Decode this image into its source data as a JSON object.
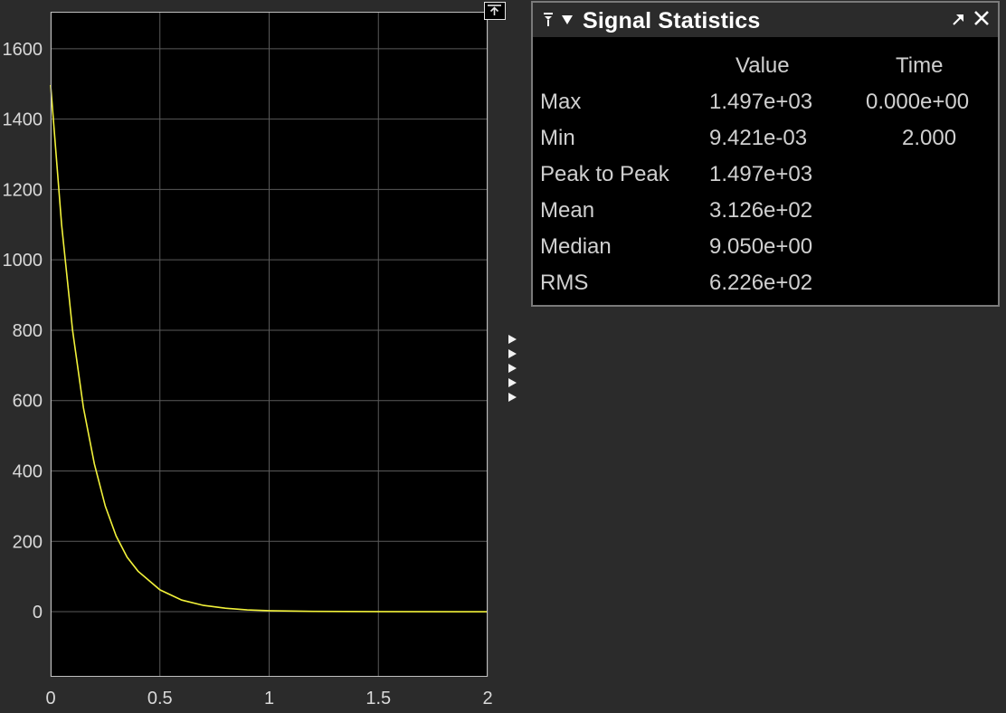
{
  "scope": {
    "axes": {
      "x_ticks": [
        "0",
        "0.5",
        "1",
        "1.5",
        "2"
      ],
      "y_ticks": [
        "1600",
        "1400",
        "1200",
        "1000",
        "800",
        "600",
        "400",
        "200",
        "0"
      ],
      "background": "#000000",
      "grid_color": "#5a5a5a",
      "trace_color": "#f2f23a",
      "label_color": "#d9d9d9"
    },
    "chart_data": {
      "type": "line",
      "title": "",
      "xlabel": "",
      "ylabel": "",
      "xlim": [
        0,
        2
      ],
      "ylim": [
        -185,
        1705
      ],
      "grid": true,
      "series": [
        {
          "x": [
            0,
            0.05,
            0.1,
            0.15,
            0.2,
            0.25,
            0.3,
            0.35,
            0.4,
            0.5,
            0.6,
            0.7,
            0.8,
            0.9,
            1.0,
            1.2,
            1.5,
            2.0
          ],
          "y": [
            1497,
            1100,
            800,
            580,
            420,
            300,
            215,
            155,
            115,
            62,
            33,
            18,
            10,
            5,
            3,
            1,
            0.3,
            0.01
          ]
        }
      ]
    },
    "undock_icon": "undock-icon",
    "side_arrow_icon": "triangle-right-icon"
  },
  "stats": {
    "title": "Signal Statistics",
    "pin_icon": "pin-icon",
    "collapse_icon": "triangle-down-icon",
    "undock_icon": "undock-arrow-icon",
    "close_icon": "close-icon",
    "columns": {
      "value": "Value",
      "time": "Time"
    },
    "rows": [
      {
        "label": "Max",
        "value": "1.497e+03",
        "time": "0.000e+00"
      },
      {
        "label": "Min",
        "value": "9.421e-03",
        "time": "2.000"
      },
      {
        "label": "Peak to Peak",
        "value": "1.497e+03",
        "time": ""
      },
      {
        "label": "Mean",
        "value": "3.126e+02",
        "time": ""
      },
      {
        "label": "Median",
        "value": "9.050e+00",
        "time": ""
      },
      {
        "label": "RMS",
        "value": "6.226e+02",
        "time": ""
      }
    ]
  }
}
